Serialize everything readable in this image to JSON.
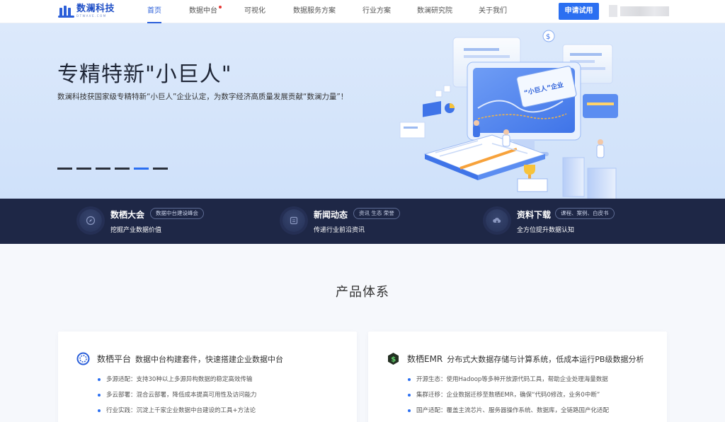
{
  "nav": {
    "logo_name": "数澜科技",
    "logo_sub": "DTWAVE.COM",
    "items": [
      {
        "label": "首页",
        "active": true
      },
      {
        "label": "数据中台",
        "badge": true
      },
      {
        "label": "可视化"
      },
      {
        "label": "数据服务方案"
      },
      {
        "label": "行业方案"
      },
      {
        "label": "数澜研究院"
      },
      {
        "label": "关于我们"
      }
    ],
    "apply_label": "申请试用"
  },
  "hero": {
    "title": "专精特新\"小巨人\"",
    "desc": "数澜科技获国家级专精特新“小巨人”企业认定，为数字经济高质量发展贡献“数澜力量”！",
    "illustration_badge": "“小巨人”企业",
    "slides": 6,
    "active_slide": 4
  },
  "features": [
    {
      "title": "数栖大会",
      "tag": "数据中台建设峰会",
      "sub": "挖掘产业数据价值",
      "icon": "compass-icon"
    },
    {
      "title": "新闻动态",
      "tag": "资讯 生态 荣誉",
      "sub": "传递行业前沿资讯",
      "icon": "news-icon"
    },
    {
      "title": "资料下载",
      "tag": "课程、案例、白皮书",
      "sub": "全方位提升数据认知",
      "icon": "cloud-download-icon"
    }
  ],
  "products": {
    "title": "产品体系",
    "cards": [
      {
        "name": "数栖平台",
        "slogan": "数据中台构建套件，快速搭建企业数据中台",
        "icon": "ring-icon",
        "points": [
          "多源适配：支持30种以上多源异构数据的稳定高效传输",
          "多云部署：混合云部署，降低成本提高可用性及访问能力",
          "行业实践：沉淀上千家企业数据中台建设的工具+方法论"
        ]
      },
      {
        "name": "数栖EMR",
        "slogan": "分布式大数据存储与计算系统，低成本运行PB级数据分析",
        "icon": "dollar-hex-icon",
        "points": [
          "开源生态：使用Hadoop等多种开放源代码工具，帮助企业处理海量数据",
          "集群迁移：企业数据迁移至数栖EMR，确保“代码0修改，业务0中断”",
          "国产适配：覆盖主流芯片、服务器操作系统、数据库，全链路国产化适配"
        ]
      }
    ]
  },
  "colors": {
    "accent": "#2b6ff1",
    "band": "#1e2746",
    "hero_bg": "#d6e6fb"
  }
}
